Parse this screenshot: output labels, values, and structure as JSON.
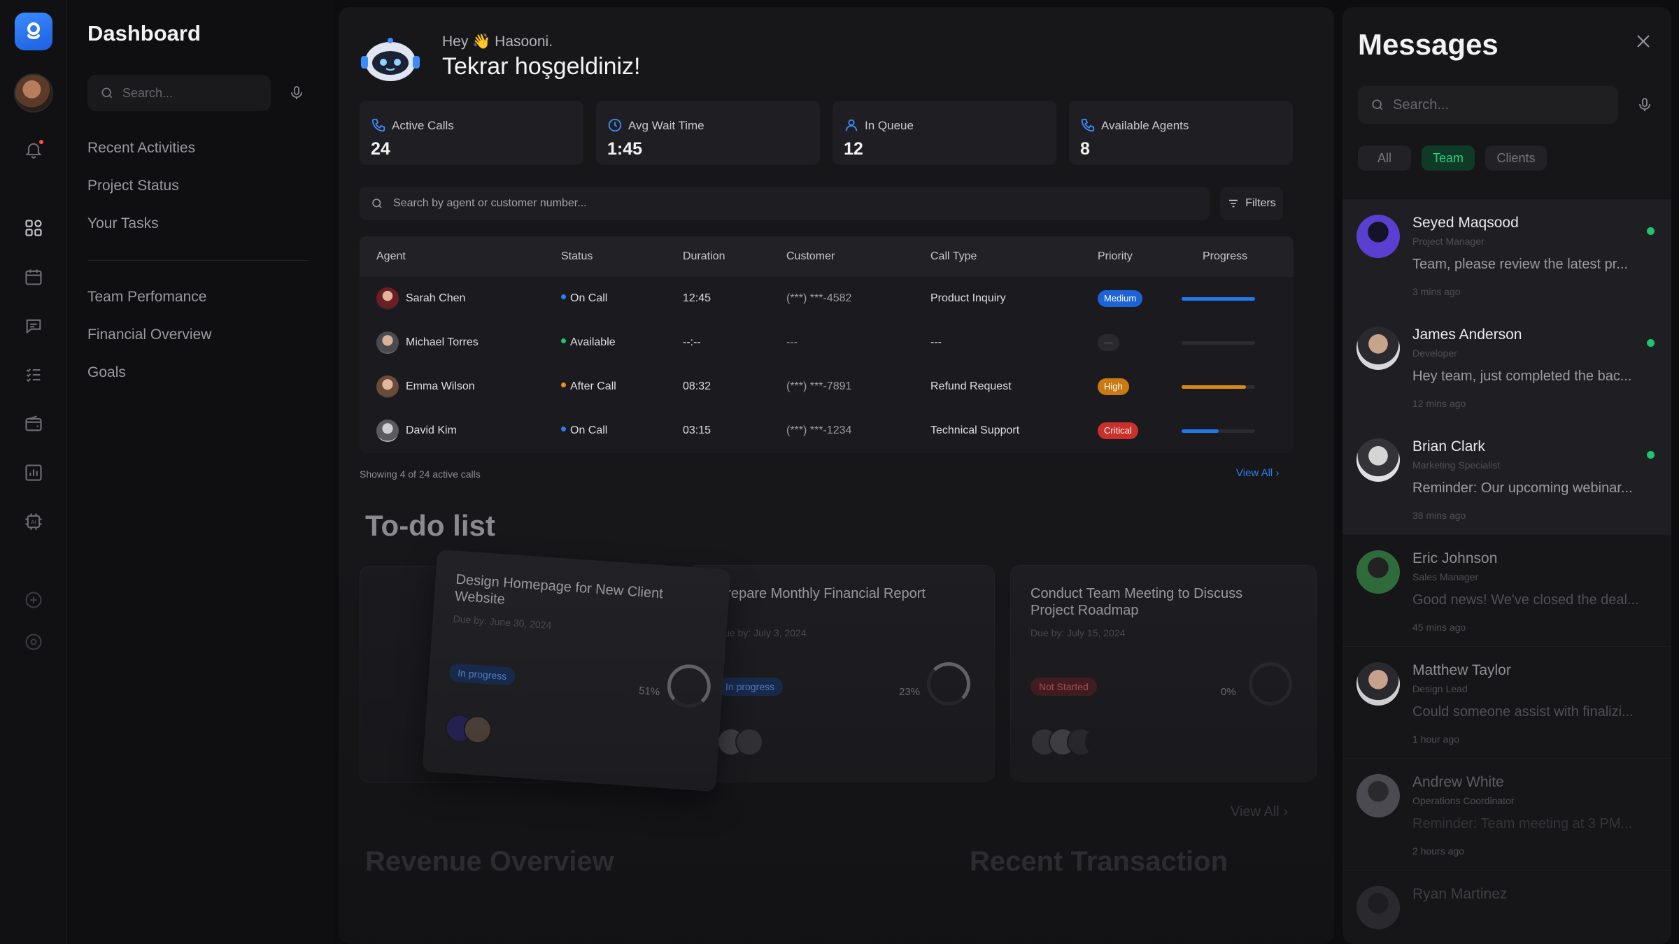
{
  "sidebar": {
    "title": "Dashboard",
    "search_placeholder": "Search...",
    "links_top": [
      "Recent Activities",
      "Project Status",
      "Your Tasks"
    ],
    "links_bottom": [
      "Team Perfomance",
      "Financial Overview",
      "Goals"
    ]
  },
  "rail": {
    "icons": [
      "bell-icon",
      "grid-icon",
      "calendar-icon",
      "chat-icon",
      "checklist-icon",
      "wallet-icon",
      "chart-icon",
      "ai-icon",
      "plus-circle-icon",
      "settings-icon"
    ]
  },
  "header": {
    "greeting": "Hey 👋 Hasooni.",
    "welcome": "Tekrar hoşgeldiniz!"
  },
  "stats": [
    {
      "label": "Active Calls",
      "value": "24",
      "icon": "phone-icon"
    },
    {
      "label": "Avg Wait Time",
      "value": "1:45",
      "icon": "clock-icon"
    },
    {
      "label": "In Queue",
      "value": "12",
      "icon": "user-icon"
    },
    {
      "label": "Available Agents",
      "value": "8",
      "icon": "phone-icon"
    }
  ],
  "calls": {
    "search_placeholder": "Search by agent or customer number...",
    "filters_label": "Filters",
    "columns": [
      "Agent",
      "Status",
      "Duration",
      "Customer",
      "Call Type",
      "Priority",
      "Progress"
    ],
    "rows": [
      {
        "agent": "Sarah Chen",
        "status": "On Call",
        "status_color": "#2f7df4",
        "duration": "12:45",
        "customer": "(***) ***-4582",
        "call_type": "Product Inquiry",
        "priority": "Medium",
        "priority_color": "#1d63d8",
        "progress": 1.0,
        "progress_color": "#2277f0"
      },
      {
        "agent": "Michael Torres",
        "status": "Available",
        "status_color": "#22c36d",
        "duration": "--:--",
        "customer": "---",
        "call_type": "---",
        "priority": "---",
        "priority_color": "#2a2a2e",
        "progress": 0,
        "progress_color": "#2b2b30"
      },
      {
        "agent": "Emma Wilson",
        "status": "After Call",
        "status_color": "#f08a24",
        "duration": "08:32",
        "customer": "(***) ***-7891",
        "call_type": "Refund Request",
        "priority": "High",
        "priority_color": "#c97a12",
        "progress": 0.88,
        "progress_color": "#d98a14"
      },
      {
        "agent": "David Kim",
        "status": "On Call",
        "status_color": "#2f7df4",
        "duration": "03:15",
        "customer": "(***) ***-1234",
        "call_type": "Technical Support",
        "priority": "Critical",
        "priority_color": "#c9302c",
        "progress": 0.5,
        "progress_color": "#2277f0"
      }
    ],
    "showing": "Showing 4 of 24 active calls",
    "view_all": "View All"
  },
  "todo": {
    "title": "To-do list",
    "cards": [
      {
        "title": "Design Homepage for New Client Website",
        "due": "Due by: June 30, 2024",
        "status": "In progress",
        "percent": "51%"
      },
      {
        "title": "Prepare Monthly Financial Report",
        "due": "Due by: July 3, 2024",
        "status": "In progress",
        "percent": "23%"
      },
      {
        "title": "Conduct Team Meeting to Discuss Project Roadmap",
        "due": "Due by: July 15, 2024",
        "status": "Not Started",
        "percent": "0%"
      }
    ],
    "view_all": "View All"
  },
  "sections": {
    "revenue": "Revenue Overview",
    "transactions": "Recent  Transaction"
  },
  "messages": {
    "title": "Messages",
    "search_placeholder": "Search...",
    "filters": [
      "All",
      "Team",
      "Clients"
    ],
    "items": [
      {
        "name": "Seyed Maqsood",
        "role": "Project Manager",
        "text": "Team, please review the latest pr...",
        "time": "3 mins ago",
        "online": true
      },
      {
        "name": "James Anderson",
        "role": "Developer",
        "text": "Hey team, just completed the bac...",
        "time": "12 mins ago",
        "online": true
      },
      {
        "name": "Brian Clark",
        "role": "Marketing Specialist",
        "text": "Reminder: Our upcoming webinar...",
        "time": "38 mins ago",
        "online": true
      },
      {
        "name": "Eric Johnson",
        "role": "Sales Manager",
        "text": "Good news! We've closed the deal...",
        "time": "45 mins ago",
        "online": false
      },
      {
        "name": "Matthew Taylor",
        "role": "Design Lead",
        "text": "Could someone assist with finalizi...",
        "time": "1 hour ago",
        "online": false
      },
      {
        "name": "Andrew White",
        "role": "Operations Coordinator",
        "text": "Reminder: Team meeting at 3 PM...",
        "time": "2 hours ago",
        "online": false
      },
      {
        "name": "Ryan Martinez",
        "role": "",
        "text": "",
        "time": "",
        "online": false
      }
    ]
  }
}
